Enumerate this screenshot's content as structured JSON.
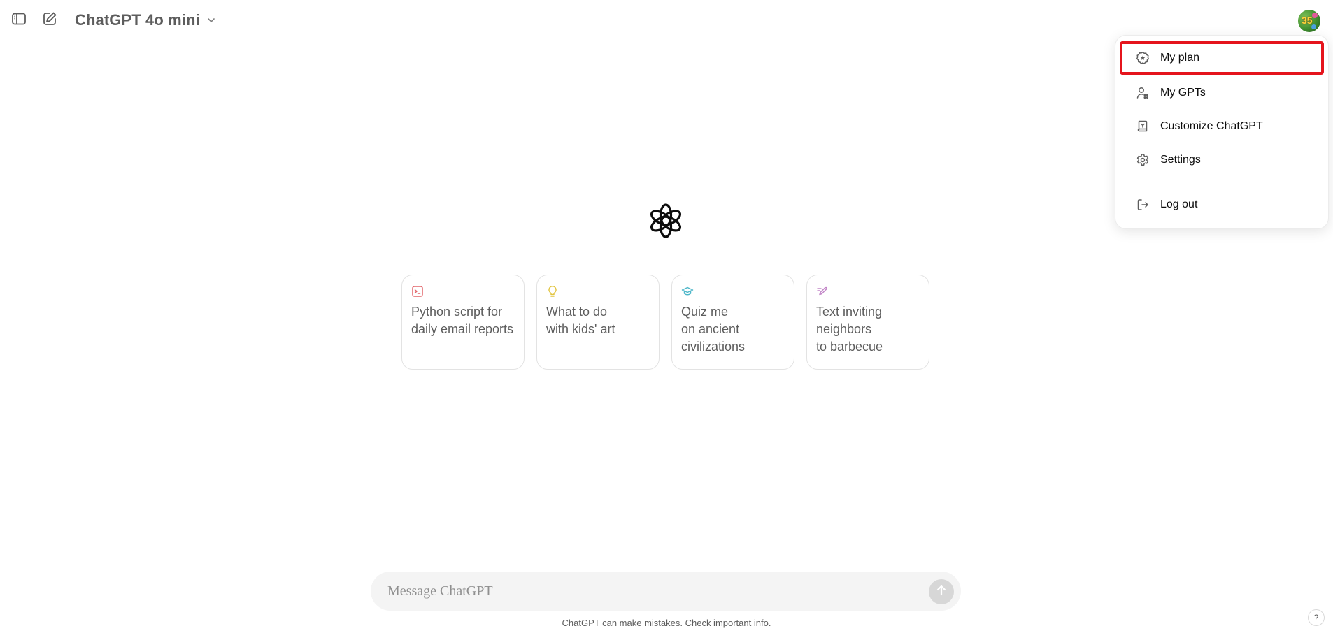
{
  "header": {
    "model_title": "ChatGPT 4o mini",
    "sidebar_toggle_icon": "sidebar-icon",
    "new_chat_icon": "edit-icon",
    "avatar_text": "35"
  },
  "menu": {
    "items": [
      {
        "label": "My plan",
        "icon": "plan-icon"
      },
      {
        "label": "My GPTs",
        "icon": "gpts-icon"
      },
      {
        "label": "Customize ChatGPT",
        "icon": "customize-icon"
      },
      {
        "label": "Settings",
        "icon": "gear-icon"
      },
      {
        "label": "Log out",
        "icon": "logout-icon"
      }
    ]
  },
  "suggestions": [
    {
      "text": "Python script for\ndaily email reports",
      "icon": "terminal-icon",
      "color": "#e2656a"
    },
    {
      "text": "What to do\nwith kids' art",
      "icon": "lightbulb-icon",
      "color": "#e2c541"
    },
    {
      "text": "Quiz me\non ancient\ncivilizations",
      "icon": "graduation-cap-icon",
      "color": "#35ae47"
    },
    {
      "text": "Text inviting\nneighbors\nto barbecue",
      "icon": "pen-icon",
      "color": "#c285c7"
    }
  ],
  "composer": {
    "placeholder": "Message ChatGPT"
  },
  "footer": {
    "disclaimer": "ChatGPT can make mistakes. Check important info.",
    "help_label": "?"
  },
  "colors": {
    "highlight": "#e5141c",
    "text_muted": "#5d5d5d"
  }
}
